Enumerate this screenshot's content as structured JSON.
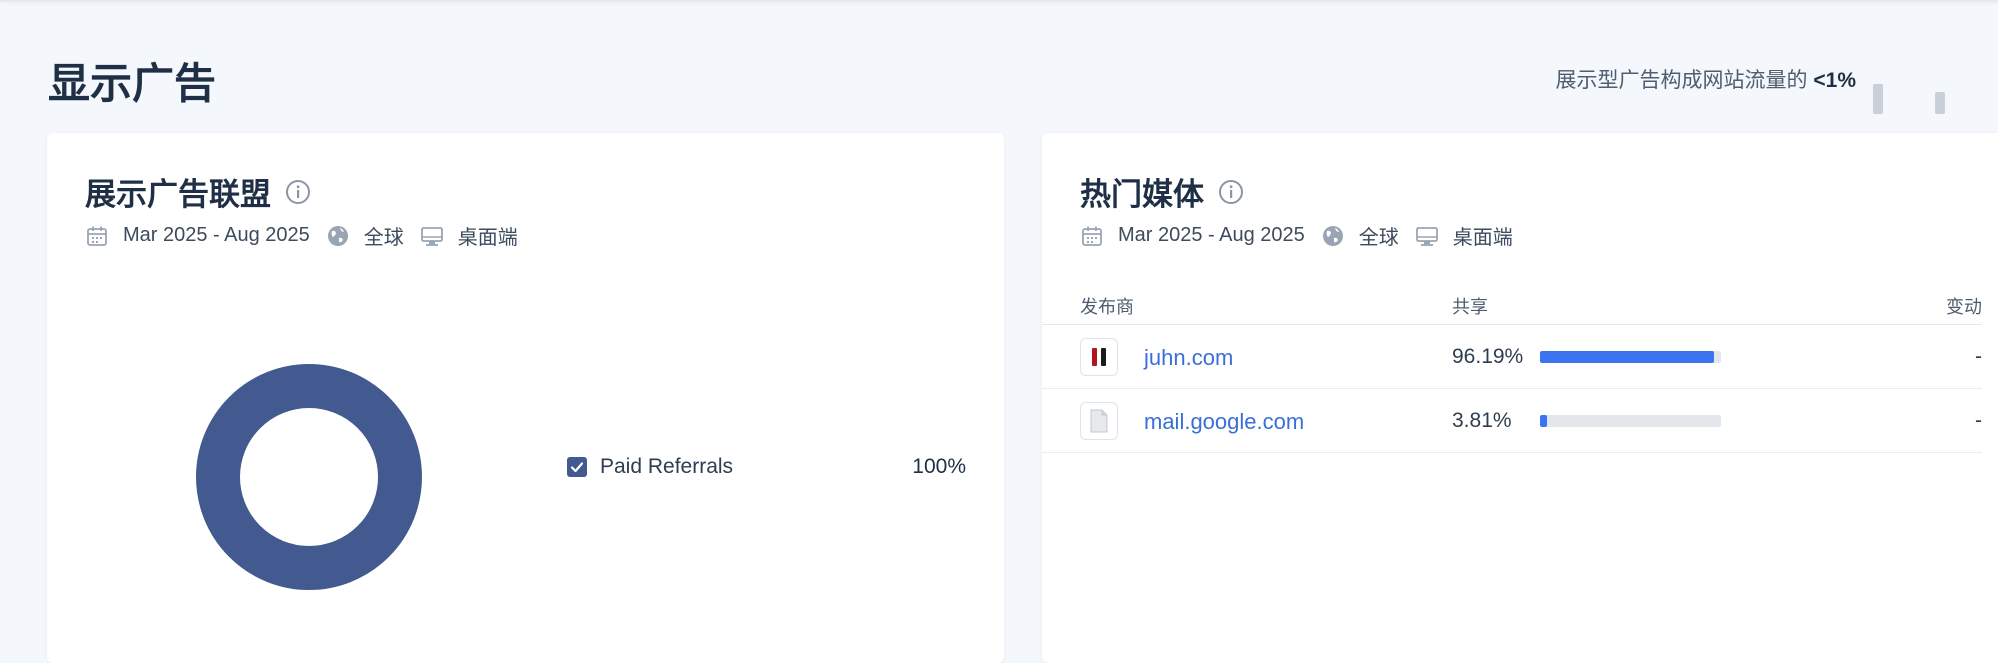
{
  "section": {
    "title": "显示广告",
    "summary_prefix": "展示型广告构成网站流量的",
    "summary_value": "<1%"
  },
  "networks_card": {
    "title": "展示广告联盟",
    "date_range": "Mar 2025 - Aug 2025",
    "region": "全球",
    "device": "桌面端",
    "legend": [
      {
        "label": "Paid Referrals",
        "value": "100%",
        "checked": true,
        "color": "#425a8f"
      }
    ],
    "chart_data": {
      "type": "pie",
      "categories": [
        "Paid Referrals"
      ],
      "values": [
        100
      ]
    }
  },
  "publishers_card": {
    "title": "热门媒体",
    "date_range": "Mar 2025 - Aug 2025",
    "region": "全球",
    "device": "桌面端",
    "columns": {
      "publisher": "发布商",
      "share": "共享",
      "change": "变动"
    },
    "rows": [
      {
        "domain": "juhn.com",
        "share": "96.19%",
        "share_fraction": 0.9619,
        "change": "-",
        "icon": "juhn-favicon"
      },
      {
        "domain": "mail.google.com",
        "share": "3.81%",
        "share_fraction": 0.0381,
        "change": "-",
        "icon": "document-icon"
      }
    ]
  },
  "colors": {
    "donut": "#425a8f",
    "bar": "#3b73f0",
    "link": "#3a6fd8"
  }
}
